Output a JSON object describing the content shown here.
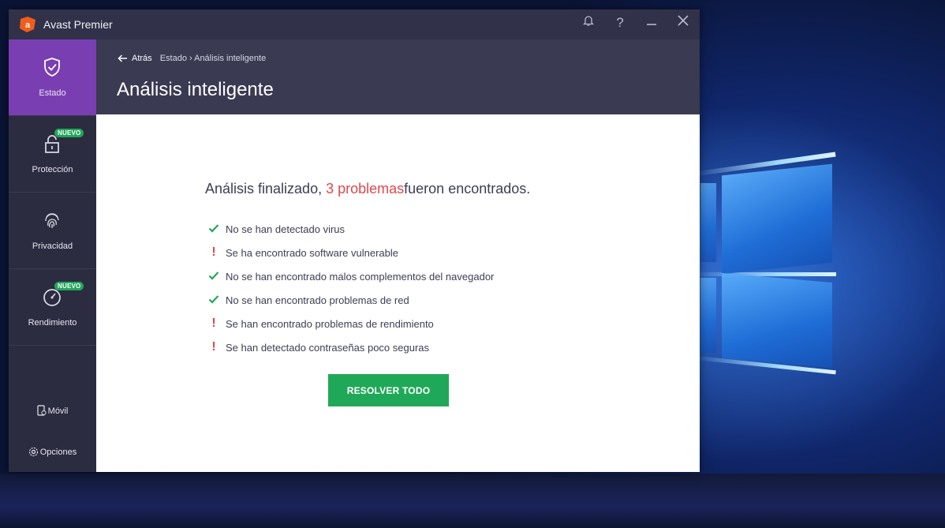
{
  "app": {
    "title": "Avast Premier"
  },
  "sidebar": {
    "items": [
      {
        "label": "Estado",
        "active": true
      },
      {
        "label": "Protección",
        "badge": "NUEVO"
      },
      {
        "label": "Privacidad"
      },
      {
        "label": "Rendimiento",
        "badge": "NUEVO"
      }
    ],
    "mobile": "Móvil",
    "options": "Opciones"
  },
  "header": {
    "back": "Atrás",
    "breadcrumb": "Estado › Análisis inteligente",
    "title": "Análisis inteligente"
  },
  "main": {
    "result_prefix": "Análisis finalizado, ",
    "result_highlight": "3 problemas",
    "result_suffix": "fueron encontrados.",
    "checks": [
      {
        "status": "ok",
        "text": "No se han detectado virus"
      },
      {
        "status": "problem",
        "text": "Se ha encontrado software vulnerable"
      },
      {
        "status": "ok",
        "text": "No se han encontrado malos complementos del navegador"
      },
      {
        "status": "ok",
        "text": "No se han encontrado problemas de red"
      },
      {
        "status": "problem",
        "text": "Se han encontrado problemas de rendimiento"
      },
      {
        "status": "problem",
        "text": "Se han detectado contraseñas poco seguras"
      }
    ],
    "resolve_button": "RESOLVER TODO"
  },
  "colors": {
    "accent_purple": "#7a3eb3",
    "success_green": "#20a859",
    "problem_red": "#e0474c",
    "logo_orange": "#f25c1b"
  },
  "icons": {
    "titlebar": [
      "bell-icon",
      "help-icon",
      "minimize-icon",
      "close-icon"
    ],
    "sidebar": [
      "shield-check-icon",
      "lock-icon",
      "fingerprint-icon",
      "speedometer-icon",
      "mobile-icon",
      "gear-icon"
    ]
  }
}
